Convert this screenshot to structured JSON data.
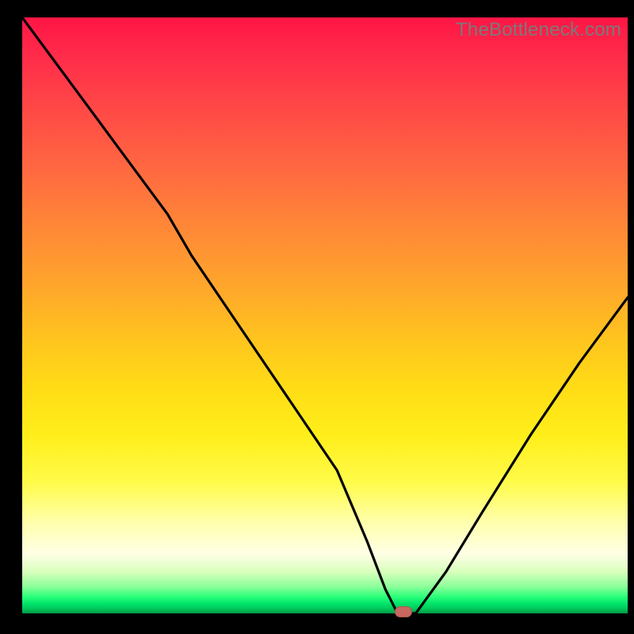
{
  "watermark": "TheBottleneck.com",
  "marker_color": "#c86860",
  "chart_data": {
    "type": "line",
    "title": "",
    "xlabel": "",
    "ylabel": "",
    "xlim": [
      0,
      100
    ],
    "ylim": [
      0,
      100
    ],
    "series": [
      {
        "name": "curve",
        "x": [
          0,
          8,
          16,
          24,
          28,
          36,
          44,
          52,
          57,
          60,
          62,
          65,
          70,
          76,
          84,
          92,
          100
        ],
        "y": [
          100,
          89,
          78,
          67,
          60,
          48,
          36,
          24,
          12,
          4,
          0,
          0,
          7,
          17,
          30,
          42,
          53
        ]
      }
    ],
    "marker": {
      "x": 63,
      "y": 0
    },
    "notes": "V-shaped bottleneck curve over red-to-green vertical gradient. Minimum (optimal point) near x≈63%. Left branch starts at top-left corner (100%), has a mild knee around x≈28, then descends roughly linearly to the floor. Right branch rises from the floor to ≈53% at the right edge. Values estimated from pixels; no axes or ticks are shown."
  }
}
